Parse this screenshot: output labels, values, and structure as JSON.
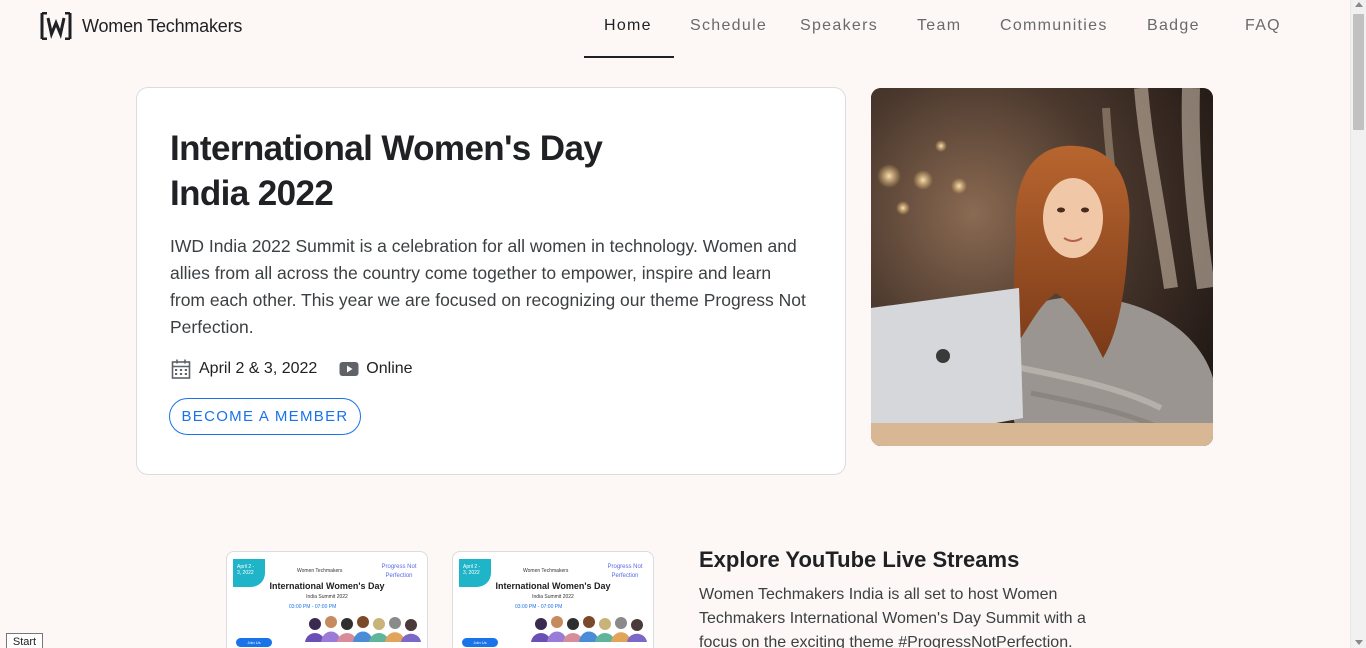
{
  "header": {
    "brand_name": "Women Techmakers",
    "nav": [
      {
        "label": "Home",
        "active": true
      },
      {
        "label": "Schedule",
        "active": false
      },
      {
        "label": "Speakers",
        "active": false
      },
      {
        "label": "Team",
        "active": false
      },
      {
        "label": "Communities",
        "active": false
      },
      {
        "label": "Badge",
        "active": false
      },
      {
        "label": "FAQ",
        "active": false
      }
    ]
  },
  "hero": {
    "title_line1": "International Women's Day",
    "title_line2": "India 2022",
    "description": "IWD India 2022 Summit is a celebration for all women in technology. Women and allies from all across the country come together to empower, inspire and learn from each other. This year we are focused on recognizing our theme Progress Not Perfection.",
    "date": "April 2 & 3, 2022",
    "date_icon": "calendar-icon",
    "mode": "Online",
    "mode_icon": "youtube-icon",
    "cta": "BECOME A MEMBER"
  },
  "posters": [
    {
      "corner_text": "April 2 - 3, 2022",
      "brand": "Women Techmakers",
      "tag": "Progress Not Perfection",
      "title": "International Women's Day",
      "subtitle": "India Summit 2022",
      "time": "03:00 PM - 07:00 PM",
      "button": "Join Us"
    },
    {
      "corner_text": "April 2 - 3, 2022",
      "brand": "Women Techmakers",
      "tag": "Progress Not Perfection",
      "title": "International Women's Day",
      "subtitle": "India Summit 2022",
      "time": "03:00 PM - 07:00 PM",
      "button": "Join Us"
    }
  ],
  "youtube": {
    "title": "Explore YouTube Live Streams",
    "description": "Women Techmakers India is all set to host Women Techmakers International Women's Day Summit with a focus on the exciting theme #ProgressNotPerfection."
  },
  "tooltip": {
    "label": "Start"
  },
  "colors": {
    "accent": "#1a73e8",
    "page_bg": "#fdf8f6",
    "card_bg": "#ffffff",
    "poster_teal": "#1fb4c8"
  }
}
